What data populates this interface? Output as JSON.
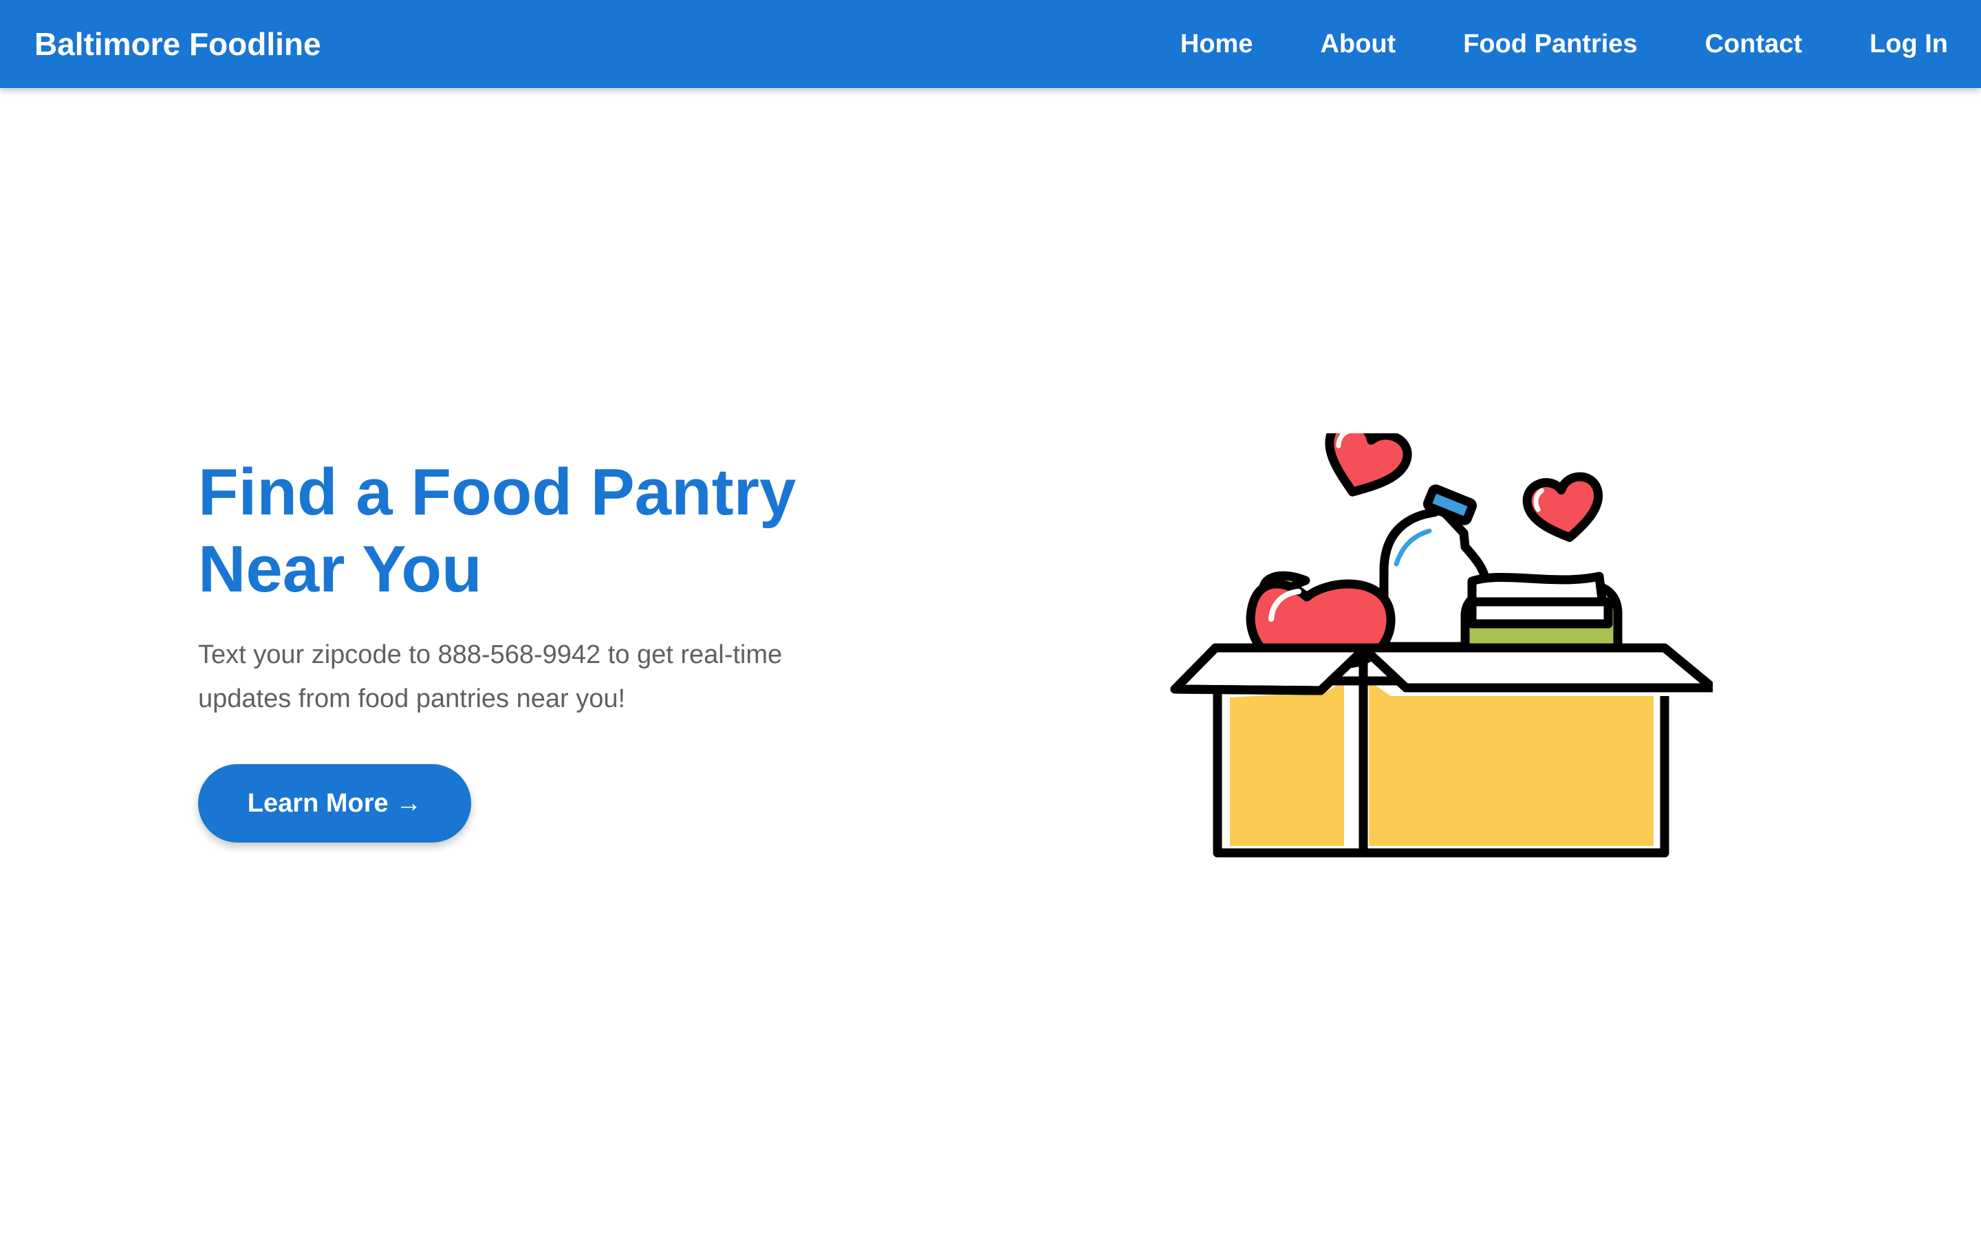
{
  "header": {
    "brand": "Baltimore Foodline",
    "nav": [
      "Home",
      "About",
      "Food Pantries",
      "Contact",
      "Log In"
    ]
  },
  "hero": {
    "title_line1": "Find a Food Pantry",
    "title_line2": "Near You",
    "subtitle": "Text your zipcode to 888-568-9942 to get real-time updates from food pantries near you!",
    "button_label": "Learn More →"
  },
  "illustration": {
    "icon": "food-donation-box-icon",
    "colors": {
      "box": "#fccb52",
      "heart": "#f55058",
      "apple": "#f55058",
      "leaf": "#a7c251",
      "jar": "#a7c251",
      "bottle_cap": "#3d9de0",
      "outline": "#000000"
    }
  },
  "colors": {
    "primary": "#1976d2",
    "subtitle_text": "#606060",
    "background": "#ffffff"
  }
}
